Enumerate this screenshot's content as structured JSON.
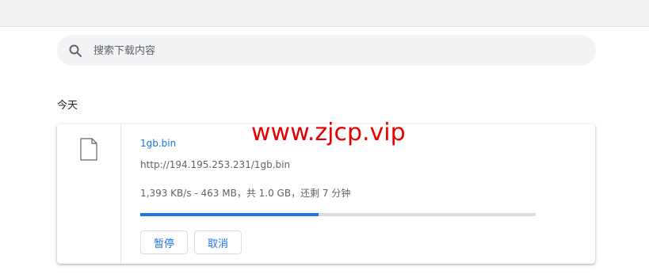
{
  "search": {
    "placeholder": "搜索下载内容",
    "icon": "search-icon"
  },
  "section": {
    "date_label": "今天"
  },
  "download": {
    "file_name": "1gb.bin",
    "source_url": "http://194.195.253.231/1gb.bin",
    "status": "1,393 KB/s - 463 MB，共 1.0 GB，还剩 7 分钟",
    "progress_fraction": 0.45,
    "file_icon": "file-icon",
    "pause_label": "暂停",
    "cancel_label": "取消"
  },
  "watermark": {
    "text": "www.zjcp.vip",
    "color": "#e60000"
  },
  "colors": {
    "accent": "#1a73e8",
    "track": "#dadce0",
    "search_bg": "#f1f3f4"
  }
}
